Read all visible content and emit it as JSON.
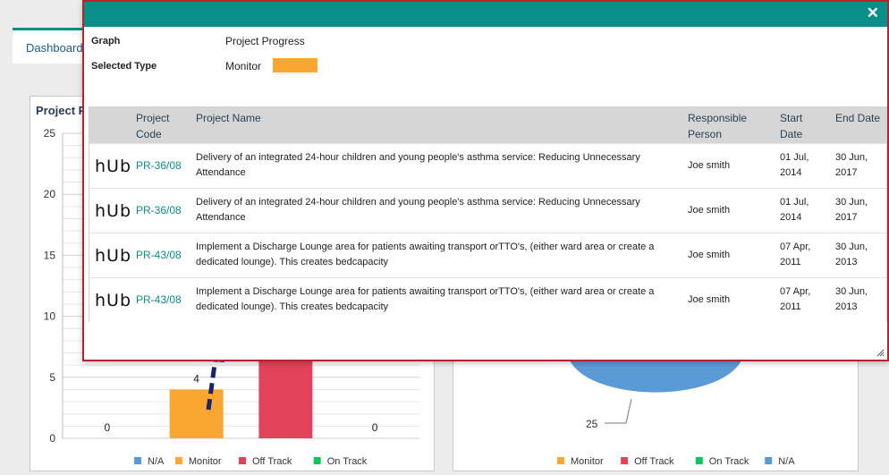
{
  "dashboard": {
    "tab_label": "Dashboard",
    "left_panel_title": "Project P"
  },
  "colors": {
    "teal": "#098f87",
    "monitor": "#faa732",
    "off_track": "#e3435a",
    "on_track": "#10c460",
    "na": "#5b9bd5"
  },
  "modal": {
    "close_icon": "close-icon",
    "graph_label": "Graph",
    "graph_value": "Project Progress",
    "selected_type_label": "Selected Type",
    "selected_type_value": "Monitor",
    "selected_type_color": "#faa732",
    "columns": {
      "code": "Project Code",
      "name": "Project Name",
      "person": "Responsible Person",
      "start": "Start Date",
      "end": "End Date"
    },
    "rows": [
      {
        "logo": "hUb",
        "code": "PR-36/08",
        "name": "Delivery of an integrated 24-hour children and young people's asthma service: Reducing Unnecessary Attendance",
        "person": "Joe smith",
        "start": "01 Jul, 2014",
        "end": "30 Jun, 2017"
      },
      {
        "logo": "hUb",
        "code": "PR-36/08",
        "name": "Delivery of an integrated 24-hour children and young people's asthma service: Reducing Unnecessary Attendance",
        "person": "Joe smith",
        "start": "01 Jul, 2014",
        "end": "30 Jun, 2017"
      },
      {
        "logo": "hUb",
        "code": "PR-43/08",
        "name": "Implement a Discharge Lounge area for patients awaiting transport orTTO's, (either ward area or create a dedicated lounge). This creates bedcapacity",
        "person": "Joe smith",
        "start": "07 Apr, 2011",
        "end": "30 Jun, 2013"
      },
      {
        "logo": "hUb",
        "code": "PR-43/08",
        "name": "Implement a Discharge Lounge area for patients awaiting transport orTTO's, (either ward area or create a dedicated lounge). This creates bedcapacity",
        "person": "Joe smith",
        "start": "07 Apr, 2011",
        "end": "30 Jun, 2013"
      }
    ]
  },
  "chart_data": [
    {
      "type": "bar",
      "categories": [
        "N/A",
        "Monitor",
        "Off Track",
        "On Track"
      ],
      "values": [
        0,
        4,
        12,
        0
      ],
      "data_labels": [
        "0",
        "4",
        "",
        "0"
      ],
      "colors": [
        "#5b9bd5",
        "#faa732",
        "#e3435a",
        "#10c460"
      ],
      "ylim": [
        0,
        25
      ],
      "yticks": [
        "0",
        "5",
        "10",
        "15",
        "20",
        "25"
      ],
      "legend": [
        "N/A",
        "Monitor",
        "Off Track",
        "On Track"
      ],
      "legend_position": "bottom",
      "grid": true
    },
    {
      "type": "pie",
      "visible_slice_label": "25",
      "legend": [
        "Monitor",
        "Off Track",
        "On Track",
        "N/A"
      ],
      "legend_colors": [
        "#faa732",
        "#e3435a",
        "#10c460",
        "#5b9bd5"
      ],
      "legend_position": "bottom"
    }
  ]
}
